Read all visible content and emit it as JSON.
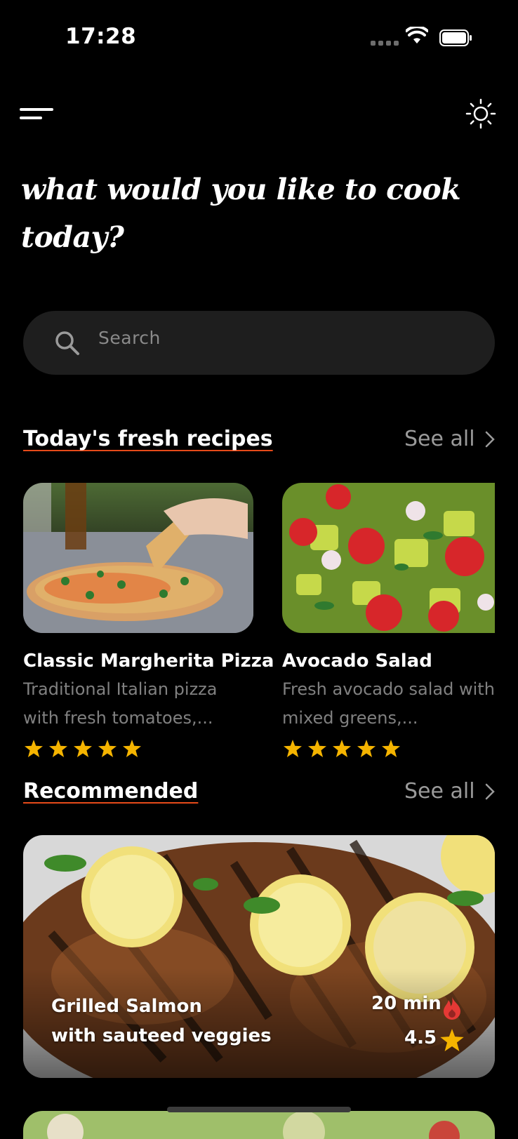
{
  "status_bar": {
    "time": "17:28"
  },
  "header": {
    "menu_icon": "menu-icon",
    "theme_icon": "sun-icon",
    "headline": "what would you like to cook today?"
  },
  "search": {
    "placeholder": "Search",
    "icon": "search-icon"
  },
  "fresh": {
    "title": "Today's fresh recipes",
    "see_all": "See all",
    "cards": [
      {
        "title": "Classic Margherita Pizza",
        "desc_line1": "Traditional Italian pizza",
        "desc_line2": "with fresh tomatoes,...",
        "rating": 5
      },
      {
        "title": "Avocado Salad",
        "desc_line1": "Fresh avocado salad with",
        "desc_line2": "mixed greens,...",
        "rating": 5
      }
    ]
  },
  "recommended": {
    "title": "Recommended",
    "see_all": "See all",
    "item": {
      "line1": "Grilled Salmon",
      "line2": "with sauteed veggies",
      "time": "20 min",
      "rating": "4.5"
    }
  },
  "colors": {
    "accent_underline": "#e64a19",
    "star": "#f5b400",
    "flame": "#e53935",
    "search_bg": "#1e1e1e"
  }
}
